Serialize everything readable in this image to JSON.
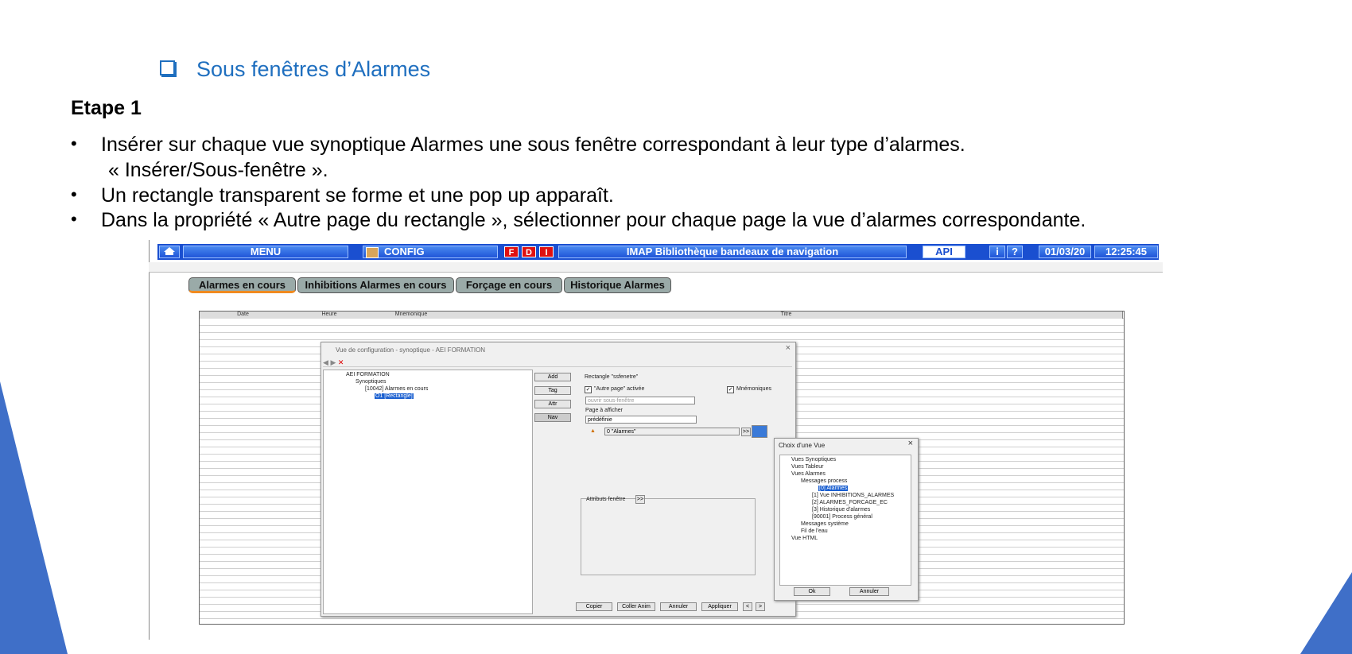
{
  "slide": {
    "title": "Sous fenêtres d’Alarmes",
    "step": "Etape 1",
    "bullets": [
      "Insérer sur chaque vue synoptique Alarmes une sous fenêtre correspondant à leur type d’alarmes.",
      "« Insérer/Sous-fenêtre ».",
      "Un rectangle transparent se forme et une pop up apparaît.",
      "Dans la propriété « Autre page du rectangle », sélectionner pour chaque page la vue d’alarmes correspondante."
    ],
    "bullet_char": "•"
  },
  "navbar": {
    "menu": "MENU",
    "config": "CONFIG",
    "badges": [
      "F",
      "D",
      "I"
    ],
    "title": "IMAP Bibliothèque bandeaux de navigation",
    "api": "API",
    "date": "01/03/20",
    "time": "12:25:45",
    "colors": {
      "bar": "#1a4fd0",
      "badge": "#e01010"
    }
  },
  "tabs": [
    "Alarmes en cours",
    "Inhibitions Alarmes en cours",
    "Forçage en cours",
    "Historique Alarmes"
  ],
  "grid": {
    "columns": [
      "Date",
      "Heure",
      "Mnemonique",
      "Titre"
    ]
  },
  "config_dialog": {
    "title": "Vue de configuration - synoptique - AEI FORMATION",
    "tree": [
      "AEI FORMATION",
      "Synoptiques",
      "[10042]  Alarmes en cours",
      "O1 [Rectangle]"
    ],
    "side_buttons": [
      "Add",
      "Tag",
      "Attr",
      "Nav"
    ],
    "rect_label": "Rectangle  \"ssfenetre\"",
    "autre_page": "\"Autre page\" activée",
    "mnemoniques": "Mnémoniques",
    "ouvrir": "ouvrir sous-fenêtre",
    "page_label": "Page à afficher",
    "predefinie": "prédéfinie",
    "alarmes_value": "0 \"Alarmes\"",
    "expand": ">>",
    "attributs": "Attributs fenêtre",
    "bottom_buttons": [
      "Copier",
      "Coller Anim",
      "Annuler",
      "Appliquer",
      "<",
      ">"
    ]
  },
  "choice_dialog": {
    "title": "Choix d'une Vue",
    "items": [
      "Vues Synoptiques",
      "Vues Tableur",
      "Vues Alarmes",
      "Messages process",
      "[0] Alarmes",
      "[1] Vue INHIBITIONS_ALARMES",
      "[2] ALARMES_FORCAGE_EC",
      "[3] Historique d'alarmes",
      "[90001] Process général",
      "Messages système",
      "Fil de l'eau",
      "Vue HTML"
    ],
    "ok": "Ok",
    "cancel": "Annuler"
  }
}
